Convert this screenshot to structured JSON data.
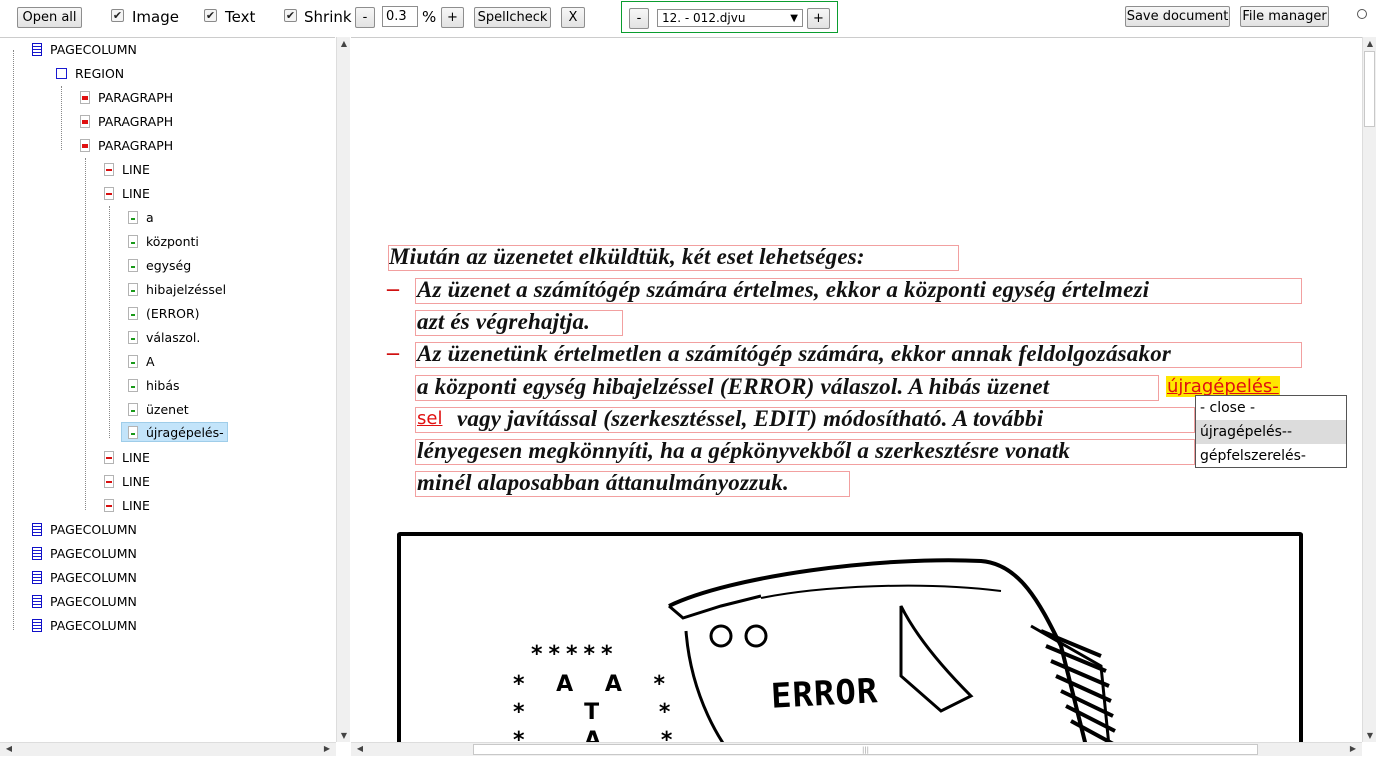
{
  "toolbar": {
    "open_all": "Open all",
    "image_label": "Image",
    "text_label": "Text",
    "shrink_label": "Shrink",
    "minus": "-",
    "shrink_value": "0.3",
    "percent": "%",
    "plus": "+",
    "spellcheck": "Spellcheck",
    "close": "X",
    "doc_prev": "-",
    "doc_next": "+",
    "doc_selected": "12. - 012.djvu",
    "save_document": "Save document",
    "file_manager": "File manager",
    "checkmark": "✔"
  },
  "tree": {
    "pagecolumn": "PAGECOLUMN",
    "region": "REGION",
    "paragraph": "PARAGRAPH",
    "line": "LINE",
    "words": [
      "a",
      "központi",
      "egység",
      "hibajelzéssel",
      "(ERROR)",
      "válaszol.",
      "A",
      "hibás",
      "üzenet",
      "újragépelés-"
    ]
  },
  "document": {
    "lines": [
      "Miután az üzenetet elküldtük, két eset lehetséges:",
      "Az üzenet a számítógép számára értelmes, ekkor a központi egység értelmezi",
      "azt és végrehajtja.",
      "Az üzenetünk értelmetlen a számítógép számára, ekkor annak feldolgozásakor",
      "a központi egység hibajelzéssel (ERROR) válaszol. A hibás üzenet",
      "vagy javítással (szerkesztéssel, EDIT) módosítható. A további",
      "lényegesen megkönnyíti, ha a gépkönyvekből a szerkesztésre vonatk",
      "minél alaposabban áttanulmányozzuk."
    ],
    "dash": "–",
    "highlight_word": "újragépelés-",
    "highlight_cont": "sel",
    "illustration_text": "ERROR",
    "stars_top": "*****",
    "stars_row2": "* A A *",
    "stars_row3": "* T *",
    "stars_row4": "* A *"
  },
  "dropdown": {
    "options": [
      "- close -",
      "újragépelés--",
      "gépfelszerelés-"
    ]
  },
  "scroll": {
    "up": "▲",
    "down": "▼",
    "left": "◀",
    "right": "▶",
    "grip": "|||"
  },
  "icons": {
    "select_arrow": "▼",
    "expanded": "◢",
    "collapsed": "▷"
  }
}
